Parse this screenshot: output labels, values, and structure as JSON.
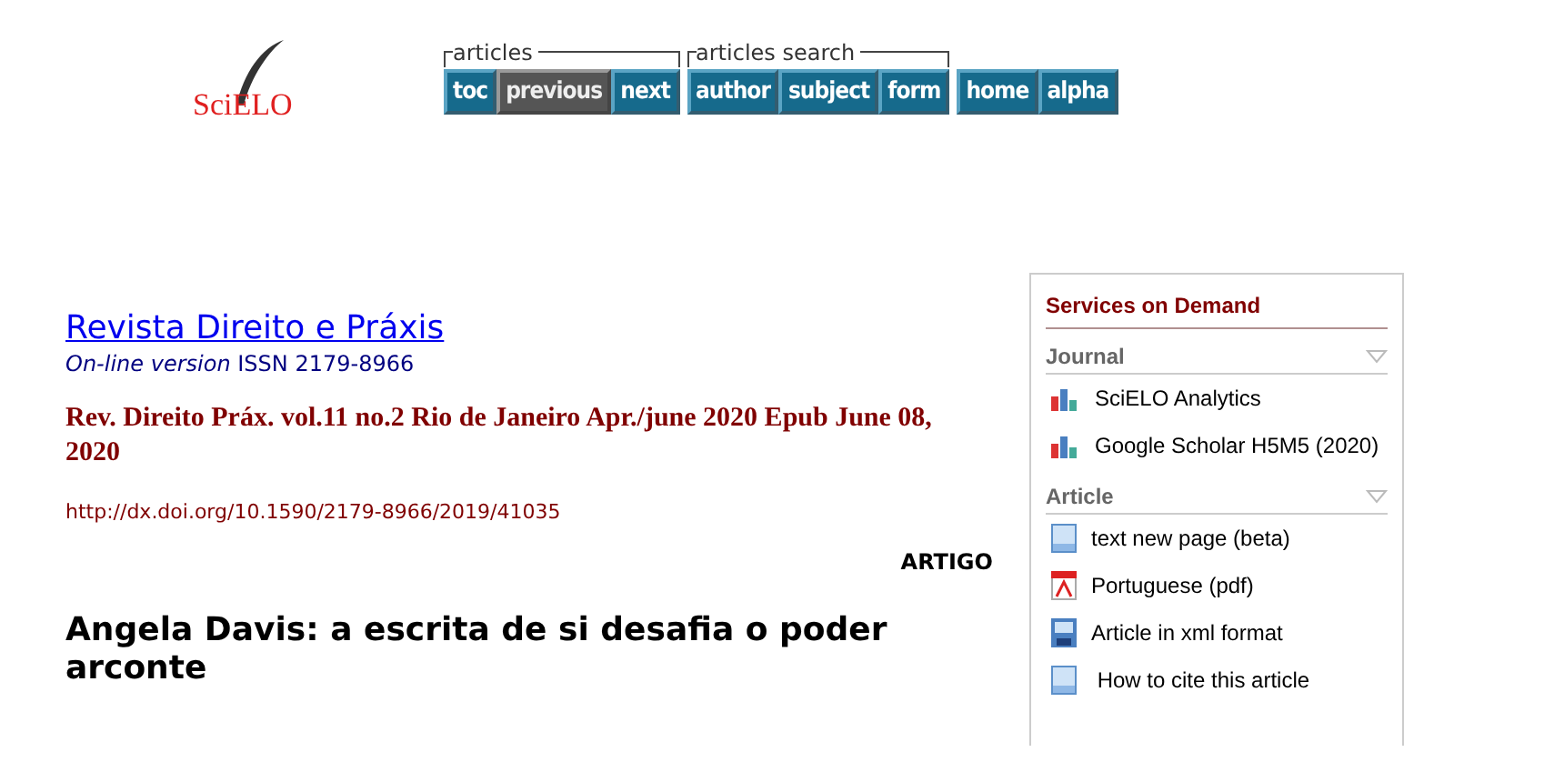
{
  "logo": {
    "text": "SciELO"
  },
  "nav_groups": [
    {
      "label": "articles",
      "buttons": [
        {
          "label": "toc",
          "disabled": false
        },
        {
          "label": "previous",
          "disabled": true
        },
        {
          "label": "next",
          "disabled": false
        }
      ]
    },
    {
      "label": "articles search",
      "buttons": [
        {
          "label": "author",
          "disabled": false
        },
        {
          "label": "subject",
          "disabled": false
        },
        {
          "label": "form",
          "disabled": false
        }
      ]
    },
    {
      "buttons": [
        {
          "label": "home",
          "disabled": false
        },
        {
          "label": "alpha",
          "disabled": false
        }
      ]
    }
  ],
  "journal": {
    "title": "Revista Direito e Práxis",
    "version": "On-line version",
    "issn": "ISSN 2179-8966"
  },
  "citation": "Rev. Direito Práx. vol.11 no.2 Rio de Janeiro Apr./june 2020  Epub June 08, 2020",
  "doi": "http://dx.doi.org/10.1590/2179-8966/2019/41035",
  "section": "ARTIGO",
  "article_title": "Angela Davis: a escrita de si desafia o poder arconte",
  "services": {
    "title": "Services on Demand",
    "sections": [
      {
        "title": "Journal",
        "items": [
          {
            "kind": "chart",
            "label": "SciELO Analytics"
          },
          {
            "kind": "chart",
            "label": "Google Scholar H5M5 (2020)"
          }
        ]
      },
      {
        "title": "Article",
        "items": [
          {
            "kind": "doc",
            "label": "text new page (beta)"
          },
          {
            "kind": "pdf",
            "label": "Portuguese (pdf)"
          },
          {
            "kind": "xml",
            "label": "Article in xml format"
          },
          {
            "kind": "doc",
            "label": " How to cite this article"
          }
        ]
      }
    ]
  }
}
